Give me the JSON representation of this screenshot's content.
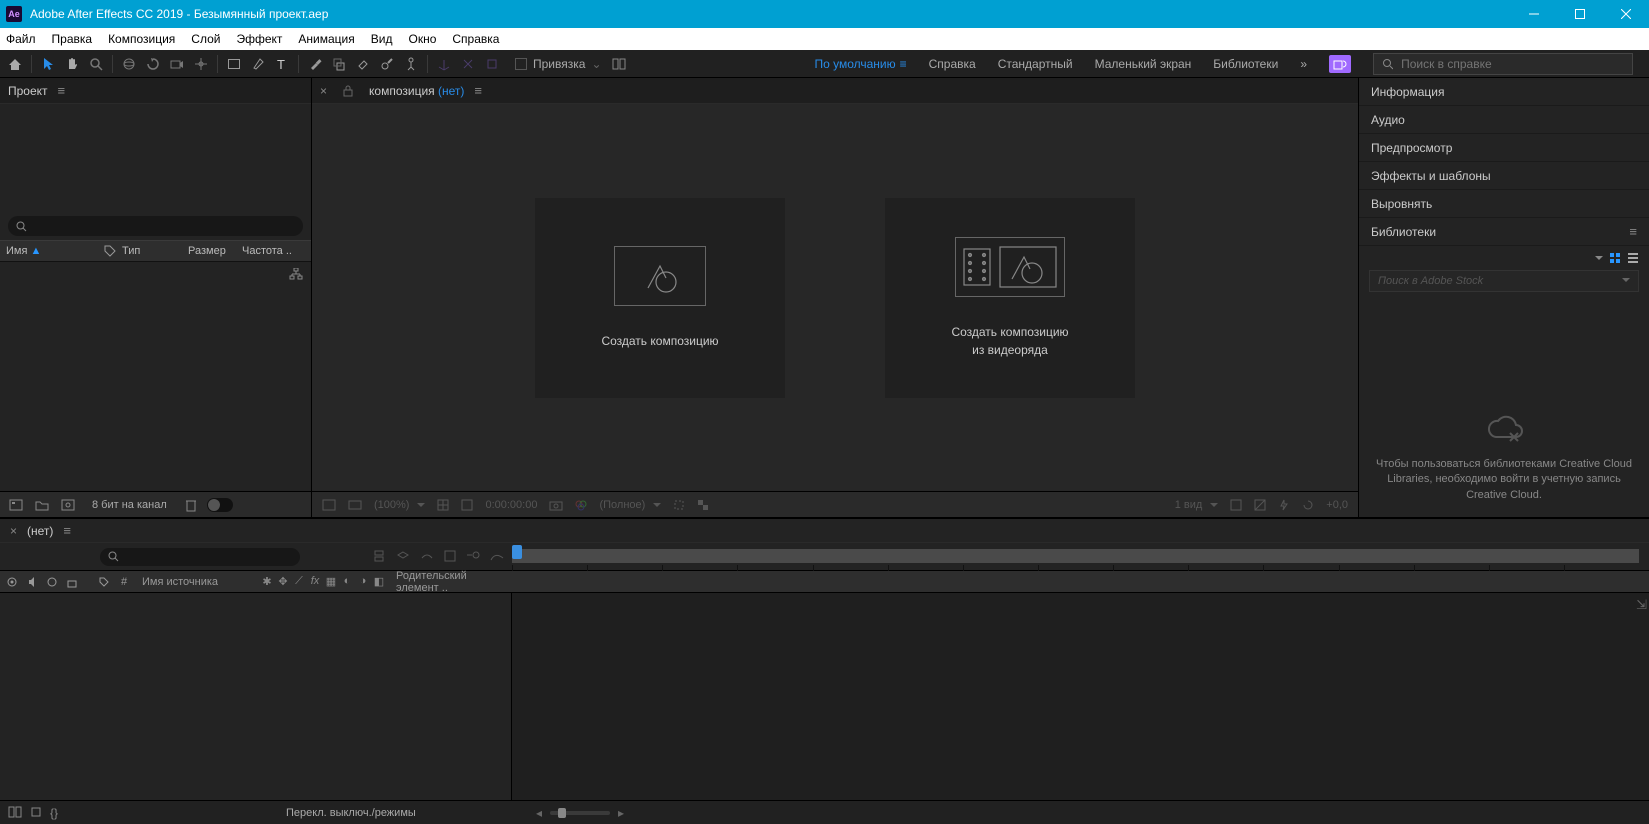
{
  "titlebar": {
    "app_icon_text": "Ae",
    "title": "Adobe After Effects CC 2019 - Безымянный проект.aep"
  },
  "menu": {
    "file": "Файл",
    "edit": "Правка",
    "composition": "Композиция",
    "layer": "Слой",
    "effect": "Эффект",
    "animation": "Анимация",
    "view": "Вид",
    "window": "Окно",
    "help": "Справка"
  },
  "toolbar": {
    "snap_label": "Привязка",
    "workspaces": {
      "default": "По умолчанию",
      "learn": "Справка",
      "standard": "Стандартный",
      "small": "Маленький экран",
      "libraries": "Библиотеки"
    },
    "search_placeholder": "Поиск в справке"
  },
  "project": {
    "tab": "Проект",
    "columns": {
      "name": "Имя",
      "type": "Тип",
      "size": "Размер",
      "rate": "Частота .."
    },
    "footer_bpc": "8 бит на канал"
  },
  "composition": {
    "tab_prefix": "композиция ",
    "tab_none": "(нет)",
    "card1": "Создать композицию",
    "card2_line1": "Создать композицию",
    "card2_line2": "из видеоряда",
    "footer": {
      "zoom": "(100%)",
      "time": "0:00:00:00",
      "quality": "(Полное)",
      "views": "1 вид",
      "exposure": "+0,0"
    }
  },
  "right": {
    "info": "Информация",
    "audio": "Аудио",
    "preview": "Предпросмотр",
    "effects": "Эффекты и шаблоны",
    "align": "Выровнять",
    "libraries": "Библиотеки",
    "stock_placeholder": "Поиск в Adobe Stock",
    "lib_msg": "Чтобы пользоваться библиотеками Creative Cloud Libraries, необходимо войти в учетную запись Creative Cloud."
  },
  "timeline": {
    "tab_none": "(нет)",
    "srcname": "Имя источника",
    "parent": "Родительский элемент ..",
    "status_toggle": "Перекл. выключ./режимы"
  }
}
